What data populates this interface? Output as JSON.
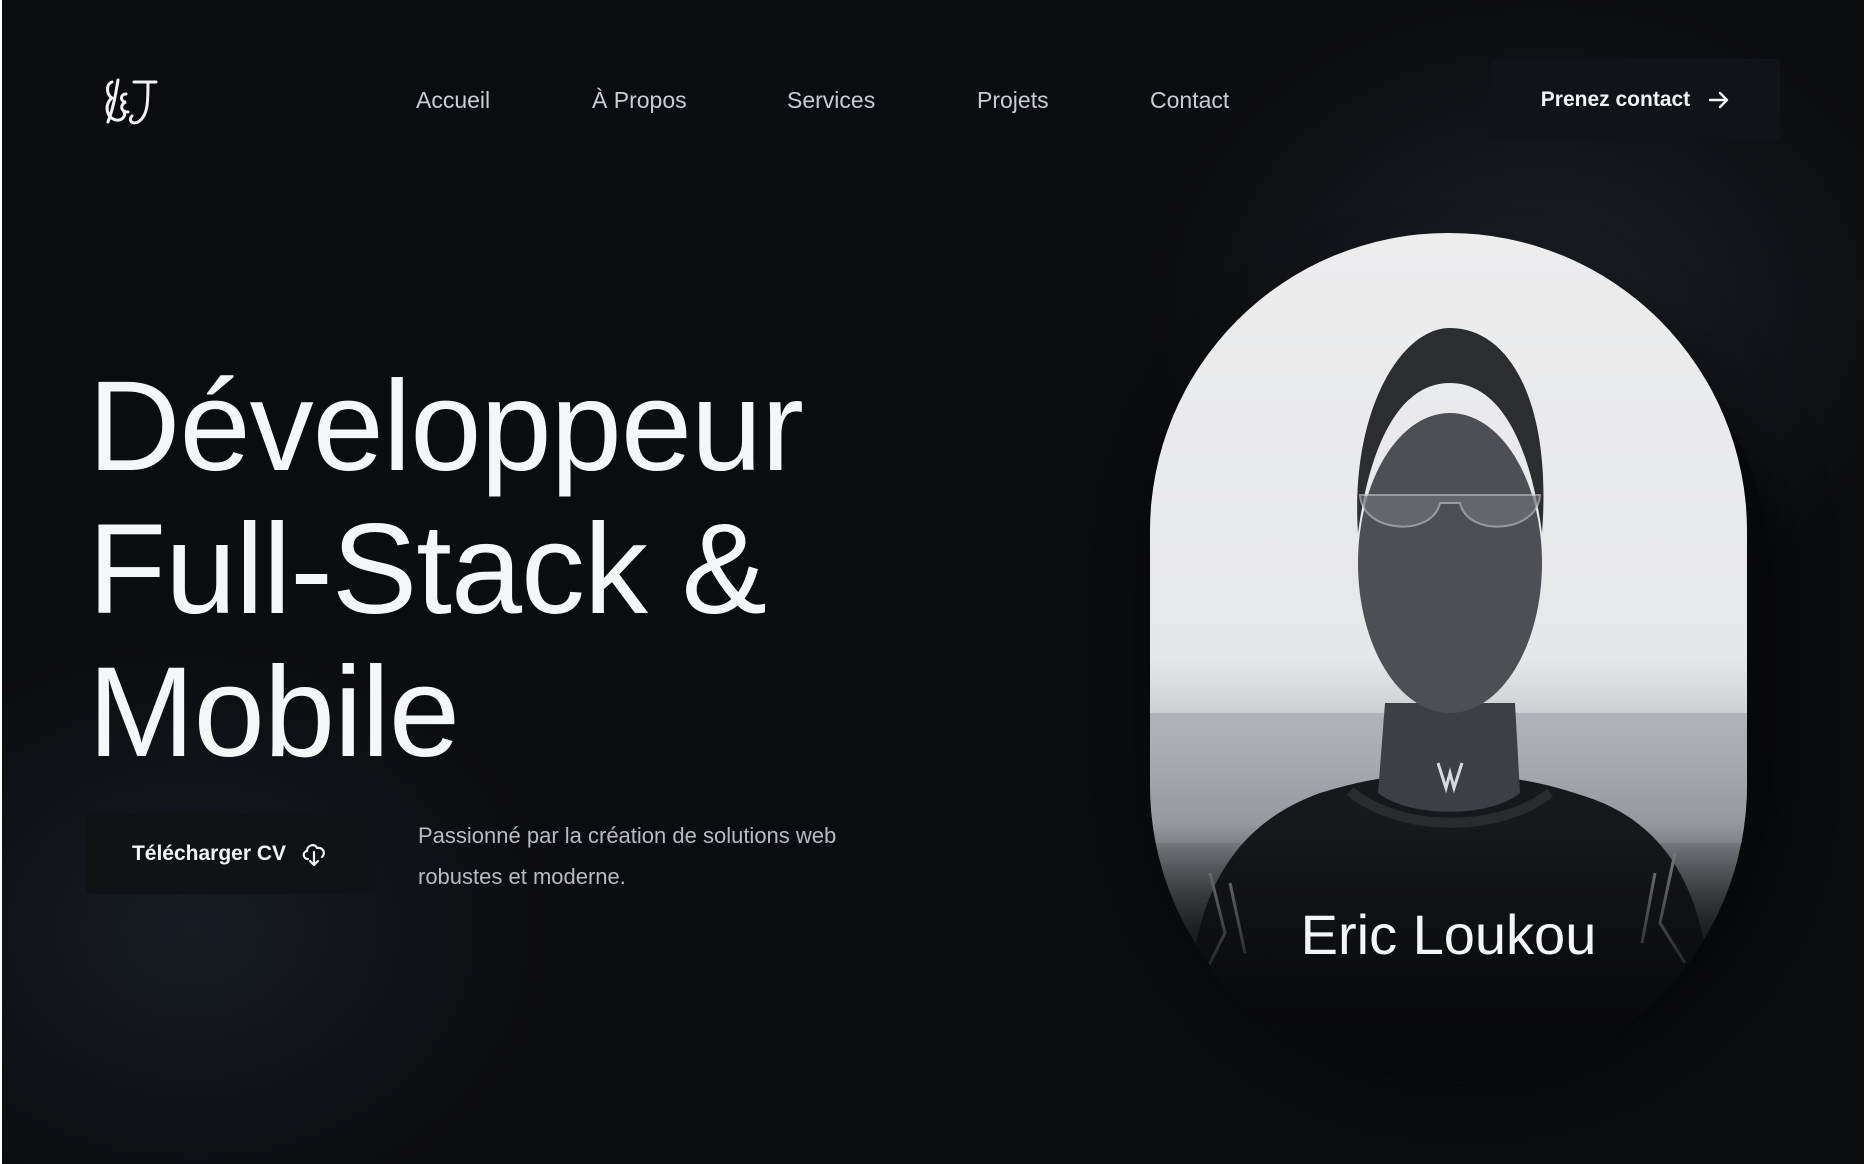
{
  "header": {
    "logo_text": "L&J",
    "nav": [
      {
        "label": "Accueil"
      },
      {
        "label": "À Propos"
      },
      {
        "label": "Services"
      },
      {
        "label": "Projets"
      },
      {
        "label": "Contact"
      }
    ],
    "cta_label": "Prenez contact",
    "cta_icon": "arrow-right-icon"
  },
  "hero": {
    "title_lines": [
      "Développeur",
      "Full-Stack &",
      "Mobile"
    ],
    "cv_button_label": "Télécharger CV",
    "cv_button_icon": "cloud-download-icon",
    "tagline": "Passionné par la création de solutions web robustes et moderne."
  },
  "portrait": {
    "name": "Eric Loukou",
    "image": "grayscale-portrait-photo"
  },
  "colors": {
    "background": "#0b0c0f",
    "button_background": "#111318",
    "text_primary": "#f5f6f8",
    "text_muted": "#b7bbc3"
  }
}
